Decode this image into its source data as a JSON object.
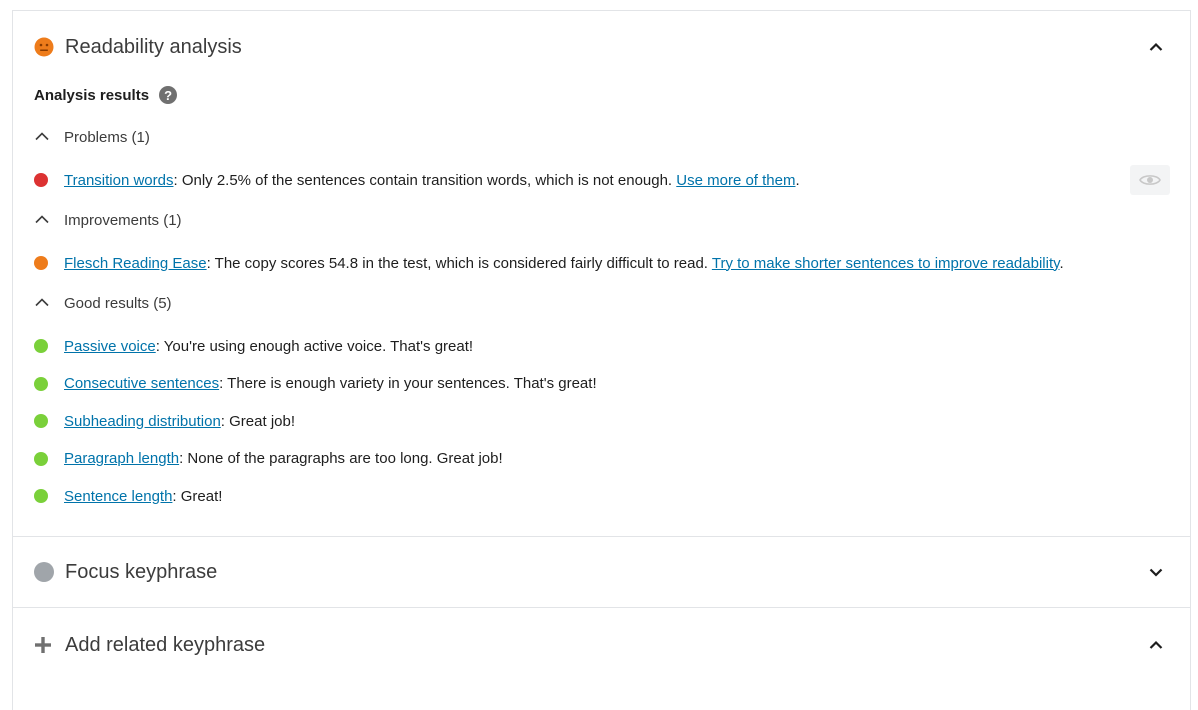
{
  "readability": {
    "title": "Readability analysis",
    "analysis_results_label": "Analysis results",
    "help_glyph": "?",
    "groups": {
      "problems": {
        "label": "Problems (1)",
        "items": [
          {
            "link": "Transition words",
            "text": ": Only 2.5% of the sentences contain transition words, which is not enough. ",
            "action_link": "Use more of them",
            "tail": ".",
            "status": "bad"
          }
        ]
      },
      "improvements": {
        "label": "Improvements (1)",
        "items": [
          {
            "link": "Flesch Reading Ease",
            "text": ": The copy scores 54.8 in the test, which is considered fairly difficult to read. ",
            "action_link": "Try to make shorter sentences to improve readability",
            "tail": ".",
            "status": "ok"
          }
        ]
      },
      "good": {
        "label": "Good results (5)",
        "items": [
          {
            "link": "Passive voice",
            "text": ": You're using enough active voice. That's great!"
          },
          {
            "link": "Consecutive sentences",
            "text": ": There is enough variety in your sentences. That's great!"
          },
          {
            "link": "Subheading distribution",
            "text": ": Great job!"
          },
          {
            "link": "Paragraph length",
            "text": ": None of the paragraphs are too long. Great job!"
          },
          {
            "link": "Sentence length",
            "text": ": Great!"
          }
        ]
      }
    }
  },
  "focus_keyphrase": {
    "title": "Focus keyphrase"
  },
  "related_keyphrase": {
    "title": "Add related keyphrase"
  },
  "colors": {
    "bad": "#dc3232",
    "ok": "#ee7c1b",
    "good": "#7ad03a",
    "link": "#0073aa",
    "neutral": "#a0a5aa"
  },
  "icons": {
    "readability": "neutral-face-icon",
    "focus": "gray-circle-icon",
    "related": "plus-icon",
    "help": "question-circle-icon",
    "eye": "eye-icon"
  }
}
